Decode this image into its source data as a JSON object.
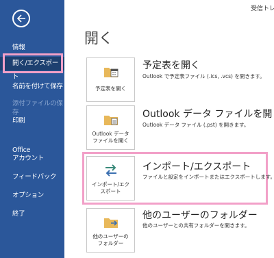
{
  "topbar": {
    "text": "受信トレイ"
  },
  "nav": {
    "items": [
      {
        "label": "情報"
      },
      {
        "label": "開く/エクスポート"
      },
      {
        "label": "名前を付けて保存"
      },
      {
        "label": "添付ファイルの保存"
      },
      {
        "label": "印刷"
      },
      {
        "label": "Office"
      },
      {
        "label": "アカウント"
      },
      {
        "label": "フィードバック"
      },
      {
        "label": "オプション"
      },
      {
        "label": "終了"
      }
    ]
  },
  "main": {
    "title": "開く",
    "rows": [
      {
        "tile_label": "予定表を開く",
        "title": "予定表を開く",
        "desc": "Outlook で予定表ファイル (.ics, .vcs) を開きます。"
      },
      {
        "tile_label_1": "Outlook データ",
        "tile_label_2": "ファイルを開く",
        "title": "Outlook データ ファイルを開く",
        "desc": "Outlook データ ファイル (.pst) を開きます。"
      },
      {
        "tile_label_1": "インポート/エク",
        "tile_label_2": "スポート",
        "title": "インポート/エクスポート",
        "desc": "ファイルと設定をインポートまたはエクスポートします。"
      },
      {
        "tile_label_1": "他のユーザーの",
        "tile_label_2": "フォルダー",
        "title": "他のユーザーのフォルダー",
        "desc": "他のユーザーとの共有フォルダーを開きます。"
      }
    ]
  },
  "colors": {
    "sidebar": "#2b579a",
    "selected": "#1d4070",
    "highlight": "#f2a0c8",
    "folder": "#e8b85a"
  }
}
